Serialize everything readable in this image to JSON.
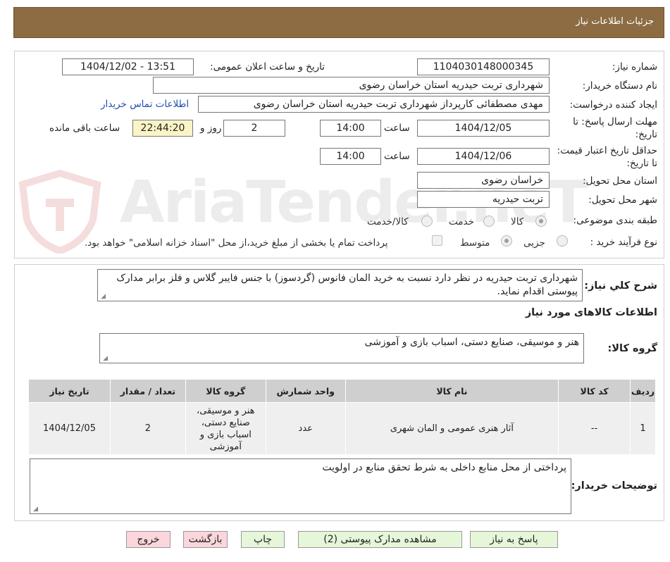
{
  "header": {
    "title": "جزئیات اطلاعات نیاز"
  },
  "form": {
    "need_number": {
      "label": "شماره نیاز:",
      "value": "1104030148000345"
    },
    "announce": {
      "label": "تاریخ و ساعت اعلان عمومی:",
      "value": "1404/12/02 - 13:51"
    },
    "buyer_org": {
      "label": "نام دستگاه خریدار:",
      "value": "شهرداری تربت حیدریه استان خراسان رضوی"
    },
    "creator": {
      "label": "ایجاد کننده درخواست:",
      "value": "مهدی مصطفائی کارپرداز شهرداری تربت حیدریه استان خراسان رضوی",
      "contact_link": "اطلاعات تماس خریدار"
    },
    "deadline": {
      "label": "مهلت ارسال پاسخ: تا تاریخ:",
      "date": "1404/12/05",
      "time_label": "ساعت",
      "time": "14:00",
      "days": "2",
      "days_label": "روز و",
      "remaining": "22:44:20",
      "remaining_label": "ساعت باقی مانده"
    },
    "validity": {
      "label": "حداقل تاریخ اعتبار قیمت: تا تاریخ:",
      "date": "1404/12/06",
      "time_label": "ساعت",
      "time": "14:00"
    },
    "province": {
      "label": "استان محل تحویل:",
      "value": "خراسان رضوی"
    },
    "city": {
      "label": "شهر محل تحویل:",
      "value": "تربت حیدریه"
    },
    "category": {
      "label": "طبقه بندی موضوعی:",
      "options": [
        "کالا",
        "خدمت",
        "کالا/خدمت"
      ],
      "selected": "کالا"
    },
    "process": {
      "label": "نوع فرآیند خرید :",
      "options": [
        "جزیی",
        "متوسط"
      ],
      "selected": "متوسط",
      "payment_note": "پرداخت تمام یا بخشی از مبلغ خرید،از محل \"اسناد خزانه اسلامی\" خواهد بود."
    }
  },
  "watermark": {
    "text": "AriaTender.neT"
  },
  "description": {
    "label": "شرح کلي نياز:",
    "value": "شهرداری تربت حیدریه در نظر دارد نسبت به خرید المان فانوس (گردسوز) با جنس فایبر گلاس و فلز برابر مدارک پیوستی اقدام نماید."
  },
  "goods_section": {
    "title": "اطلاعات کالاهای مورد نیاز",
    "group_label": "گروه کالا:",
    "group_value": "هنر و موسیقی، صنایع دستی، اسباب بازی و آموزشی"
  },
  "table": {
    "headers": [
      "ردیف",
      "کد کالا",
      "نام کالا",
      "واحد شمارش",
      "گروه کالا",
      "تعداد / مقدار",
      "تاریخ نیاز"
    ],
    "rows": [
      [
        "1",
        "--",
        "آثار هنری عمومی و المان شهری",
        "عدد",
        "هنر و موسیقی، صنایع دستی، اسباب بازی و آموزشی",
        "2",
        "1404/12/05"
      ]
    ]
  },
  "buyer_notes": {
    "label": "توضیحات خریدار:",
    "value": "پرداختی از محل منابع داخلی به شرط تحقق منابع در اولویت"
  },
  "buttons": {
    "reply": "پاسخ به نیاز",
    "attachments": "مشاهده مدارک پیوستی (2)",
    "print": "چاپ",
    "back": "بازگشت",
    "exit": "خروج"
  }
}
